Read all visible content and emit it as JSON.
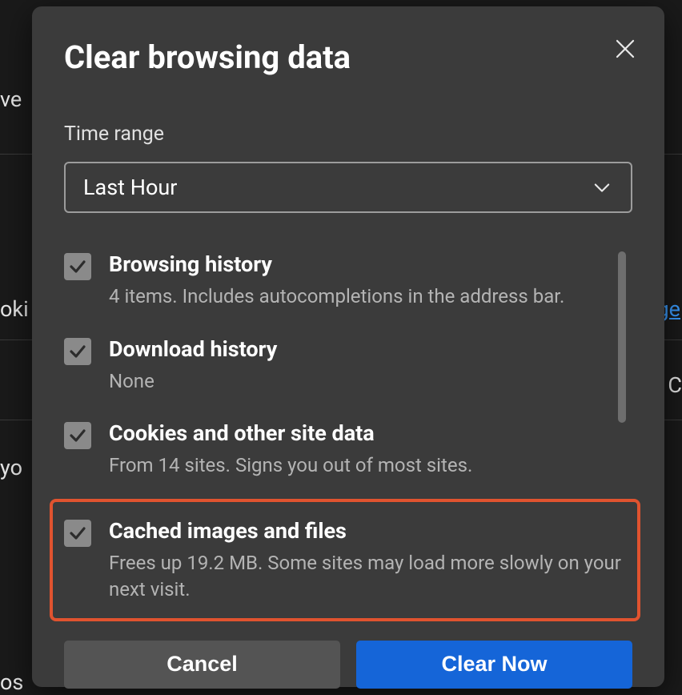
{
  "dialog": {
    "title": "Clear browsing data",
    "time_range_label": "Time range",
    "time_range_value": "Last Hour",
    "options": [
      {
        "title": "Browsing history",
        "desc": "4 items. Includes autocompletions in the address bar.",
        "checked": true
      },
      {
        "title": "Download history",
        "desc": "None",
        "checked": true
      },
      {
        "title": "Cookies and other site data",
        "desc": "From 14 sites. Signs you out of most sites.",
        "checked": true
      },
      {
        "title": "Cached images and files",
        "desc": "Frees up 19.2 MB. Some sites may load more slowly on your next visit.",
        "checked": true,
        "highlighted": true
      }
    ],
    "cancel_label": "Cancel",
    "confirm_label": "Clear Now"
  },
  "background": {
    "frag1": "ve",
    "frag2": "oki",
    "frag3": "yo",
    "frag4": "os",
    "frag5": "C",
    "link_frag": "ge"
  }
}
